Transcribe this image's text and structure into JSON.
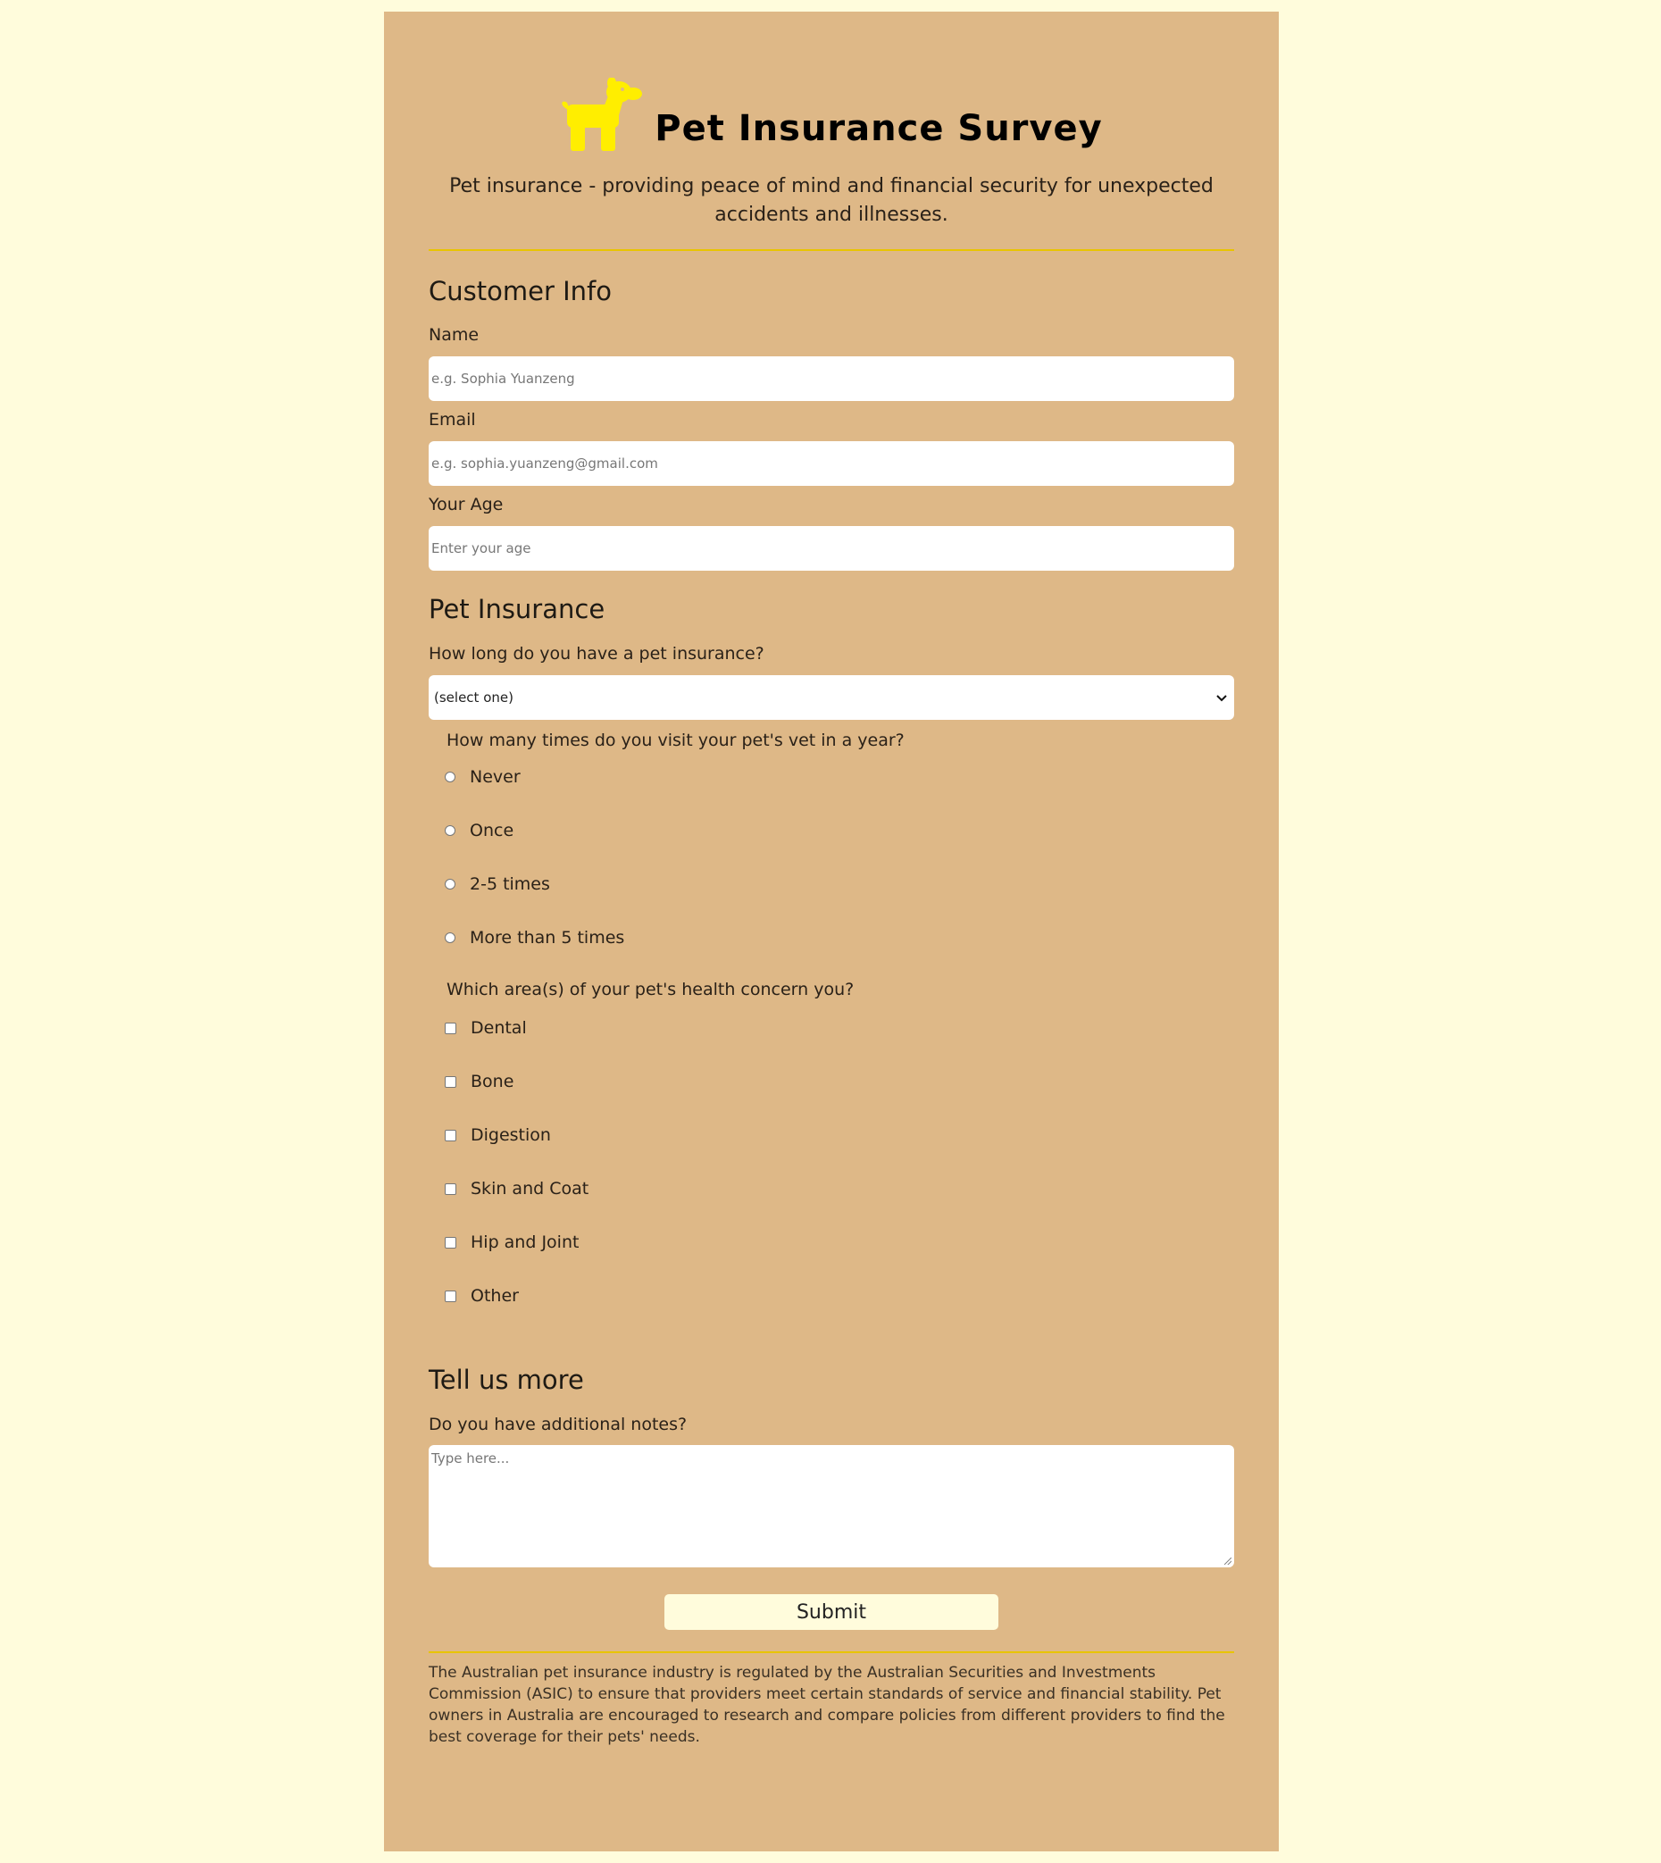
{
  "header": {
    "title": "Pet Insurance Survey",
    "tagline": "Pet insurance - providing peace of mind and financial security for unexpected accidents and illnesses.",
    "icon": "dog-icon",
    "icon_color": "#ffee00"
  },
  "customer_info": {
    "heading": "Customer Info",
    "name_label": "Name",
    "name_placeholder": "e.g. Sophia Yuanzeng",
    "email_label": "Email",
    "email_placeholder": "e.g. sophia.yuanzeng@gmail.com",
    "age_label": "Your Age",
    "age_placeholder": "Enter your age"
  },
  "pet_insurance": {
    "heading": "Pet Insurance",
    "duration_label": "How long do you have a pet insurance?",
    "duration_selected": "(select one)",
    "visits_question": "How many times do you visit your pet's vet in a year?",
    "visit_options": [
      "Never",
      "Once",
      "2-5 times",
      "More than 5 times"
    ],
    "health_question": "Which area(s) of your pet's health concern you?",
    "health_options": [
      "Dental",
      "Bone",
      "Digestion",
      "Skin and Coat",
      "Hip and Joint",
      "Other"
    ]
  },
  "tell_us_more": {
    "heading": "Tell us more",
    "notes_label": "Do you have additional notes?",
    "notes_placeholder": "Type here..."
  },
  "submit_label": "Submit",
  "footer_text": "The Australian pet insurance industry is regulated by the Australian Securities and Investments Commission (ASIC) to ensure that providers meet certain standards of service and financial stability. Pet owners in Australia are encouraged to research and compare policies from different providers to find the best coverage for their pets' needs.",
  "colors": {
    "page_background": "#fffcdc",
    "card_background": "#deb887",
    "divider": "#e8c400"
  }
}
